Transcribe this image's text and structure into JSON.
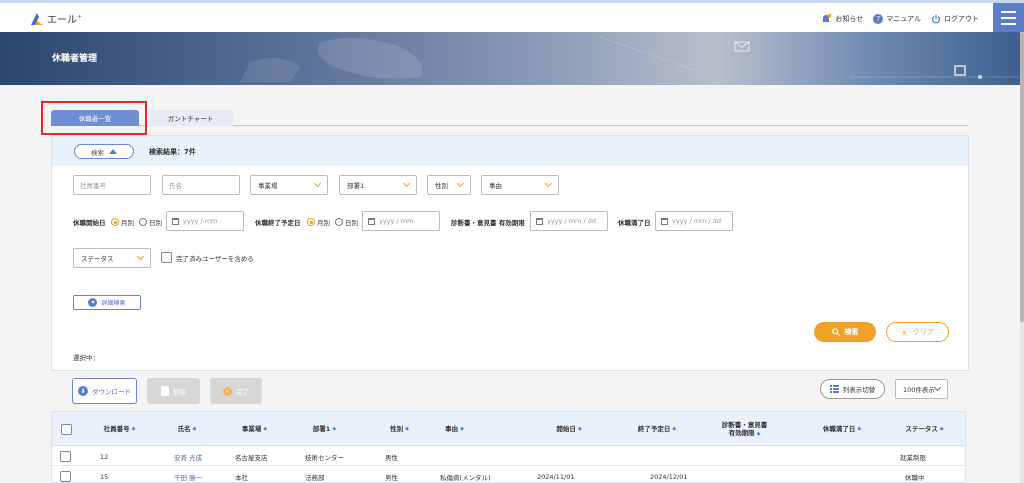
{
  "header": {
    "logo_text": "エール",
    "logo_sup": "+",
    "nav": {
      "notice": "お知らせ",
      "manual": "マニュアル",
      "logout": "ログアウト"
    }
  },
  "banner": {
    "title": "休職者管理"
  },
  "tabs": [
    {
      "label": "休職者一覧",
      "active": true
    },
    {
      "label": "ガントチャート",
      "active": false
    }
  ],
  "search": {
    "toggle_label": "検索",
    "result_label": "検索結果：7件",
    "placeholders": {
      "employee_no": "社員番号",
      "name": "氏名"
    },
    "selects": {
      "office": "事業場",
      "dept": "部署1",
      "gender": "性別",
      "reason": "事由",
      "status": "ステータス"
    },
    "leave_start": {
      "label": "休職開始日",
      "monthly": "月別",
      "daily": "日別",
      "placeholder": "yyyy / mm",
      "selected": "monthly"
    },
    "leave_end_planned": {
      "label": "休職終了予定日",
      "monthly": "月別",
      "daily": "日別",
      "placeholder": "yyyy / mm",
      "selected": "monthly"
    },
    "certificate": {
      "label": "診断書・意見書 有効期限",
      "placeholder": "yyyy / mm / dd"
    },
    "expiry": {
      "label": "休職満了日",
      "placeholder": "yyyy / mm / dd"
    },
    "include_completed_label": "完了済みユーザーを含める",
    "advanced_label": "詳細検索",
    "search_button": "検索",
    "clear_button": "クリア",
    "selected_label": "選択中："
  },
  "actions": {
    "download": "ダウンロード",
    "delete": "削除",
    "complete": "完了",
    "column_toggle": "列表示切替",
    "per_page": "100件表示"
  },
  "table": {
    "headers": {
      "employee_no": "社員番号",
      "name": "氏名",
      "office": "事業場",
      "dept": "部署1",
      "gender": "性別",
      "reason": "事由",
      "start": "開始日",
      "end_planned": "終了予定日",
      "certificate_line1": "診断書・意見書",
      "certificate_line2": "有効期限",
      "expiry": "休職満了日",
      "status": "ステータス"
    },
    "rows": [
      {
        "employee_no": "12",
        "name": "安斉 光成",
        "office": "名古屋支店",
        "dept": "技術センター",
        "gender": "男性",
        "reason": "",
        "start": "",
        "end_planned": "",
        "certificate": "",
        "expiry": "",
        "status": "就業制限"
      },
      {
        "employee_no": "15",
        "name": "千田 勝一",
        "office": "本社",
        "dept": "法務部",
        "gender": "男性",
        "reason": "私傷病(メンタル)",
        "start": "2024/11/01",
        "end_planned": "2024/12/01",
        "certificate": "",
        "expiry": "",
        "status": "休職中"
      }
    ]
  },
  "colors": {
    "accent": "#5b7fc7",
    "tab_active": "#6e8fd3",
    "orange": "#f0a12a",
    "highlight": "#e12b2b"
  }
}
